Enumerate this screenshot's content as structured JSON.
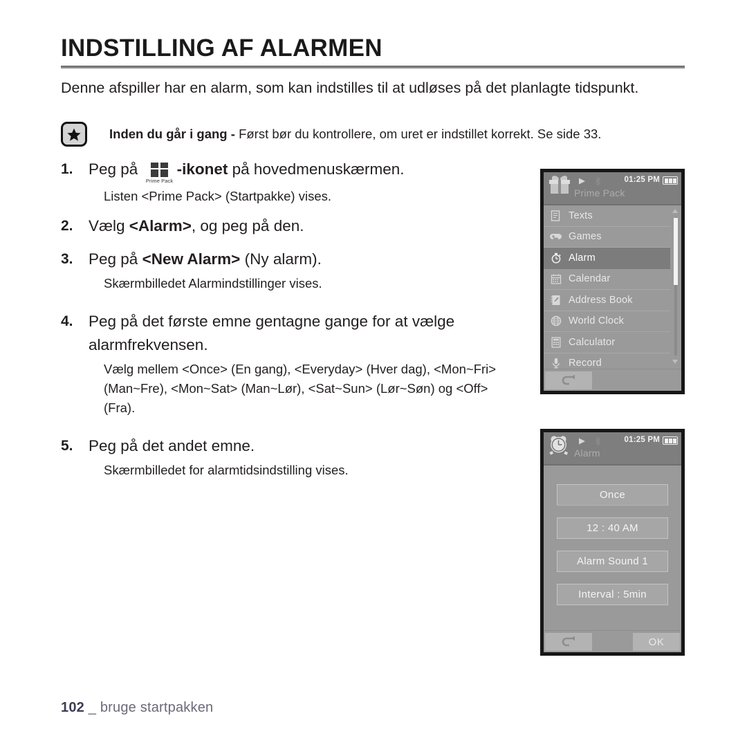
{
  "title": "INDSTILLING AF ALARMEN",
  "intro": "Denne afspiller har en alarm, som kan indstilles til at udløses på det planlagte tidspunkt.",
  "note": {
    "icon": "star-icon",
    "lead": "Inden du går i gang - ",
    "text": "Først bør du kontrollere, om uret er indstillet korrekt. Se side 33."
  },
  "steps": [
    {
      "num": "1.",
      "pre": "Peg på",
      "icon_caption": "Prime Pack",
      "bold": "-ikonet",
      "post": " på hovedmenuskærmen.",
      "sub": "Listen <Prime Pack> (Startpakke) vises."
    },
    {
      "num": "2.",
      "pre": "Vælg ",
      "bold": "<Alarm>",
      "post": ", og peg på den.",
      "sub": ""
    },
    {
      "num": "3.",
      "pre": "Peg på ",
      "bold": "<New Alarm>",
      "post": " (Ny alarm).",
      "sub": "Skærmbilledet Alarmindstillinger vises."
    },
    {
      "num": "4.",
      "pre": "Peg på det første emne gentagne gange for at vælge alarmfrekvensen.",
      "bold": "",
      "post": "",
      "sub": "Vælg mellem <Once> (En gang), <Everyday> (Hver dag), <Mon~Fri> (Man~Fre), <Mon~Sat> (Man~Lør), <Sat~Sun> (Lør~Søn) og <Off> (Fra)."
    },
    {
      "num": "5.",
      "pre": "Peg på det andet emne.",
      "bold": "",
      "post": "",
      "sub": "Skærmbilledet for alarmtidsindstilling vises."
    }
  ],
  "device_primepack": {
    "header": {
      "app_icon": "gift-box-icon",
      "app_title": "Prime Pack",
      "play_icon": "play-icon",
      "bluetooth_icon": "bluetooth-icon",
      "clock": "01:25 PM",
      "battery_icon": "battery-full-icon"
    },
    "rows": [
      {
        "icon": "texts-icon",
        "label": "Texts",
        "selected": false
      },
      {
        "icon": "games-icon",
        "label": "Games",
        "selected": false
      },
      {
        "icon": "alarm-icon",
        "label": "Alarm",
        "selected": true
      },
      {
        "icon": "calendar-icon",
        "label": "Calendar",
        "selected": false
      },
      {
        "icon": "addressbook-icon",
        "label": "Address Book",
        "selected": false
      },
      {
        "icon": "worldclock-icon",
        "label": "World Clock",
        "selected": false
      },
      {
        "icon": "calculator-icon",
        "label": "Calculator",
        "selected": false
      },
      {
        "icon": "record-icon",
        "label": "Record",
        "selected": false
      }
    ],
    "footer": {
      "back_icon": "back-arrow-icon"
    }
  },
  "device_alarm": {
    "header": {
      "app_icon": "alarm-clock-icon",
      "app_title": "Alarm",
      "play_icon": "play-icon",
      "bluetooth_icon": "bluetooth-icon",
      "clock": "01:25 PM",
      "battery_icon": "battery-full-icon"
    },
    "buttons": [
      {
        "label": "Once"
      },
      {
        "label": "12 : 40 AM"
      },
      {
        "label": "Alarm Sound 1"
      },
      {
        "label": "Interval : 5min"
      }
    ],
    "footer": {
      "back_icon": "back-arrow-icon",
      "ok_label": "OK"
    }
  },
  "footer": {
    "page_number": "102",
    "separator": "_",
    "section": "bruge startpakken"
  },
  "colors": {
    "text": "#231f20",
    "device_bg": "#9a9a9a",
    "device_header": "#7e7e7e",
    "device_selected": "#7c7c7c",
    "device_border": "#161616",
    "footer_text": "#6a6a7a"
  }
}
